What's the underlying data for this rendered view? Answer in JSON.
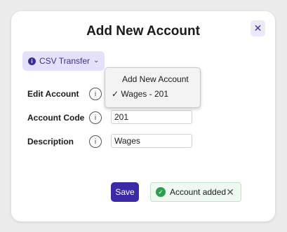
{
  "modal": {
    "title": "Add New Account",
    "close_glyph": "✕"
  },
  "csv_button": {
    "label": "CSV Transfer",
    "info_glyph": "i",
    "chevron_glyph": "⌄"
  },
  "form": {
    "info_glyph": "i",
    "edit_account_label": "Edit Account",
    "account_code_label": "Account Code",
    "account_code_value": "201",
    "description_label": "Description",
    "description_value": "Wages"
  },
  "dropdown": {
    "items": [
      {
        "label": "Add New Account",
        "checked": false
      },
      {
        "label": "Wages - 201",
        "checked": true
      }
    ],
    "check_glyph": "✓"
  },
  "save_button": {
    "label": "Save"
  },
  "toast": {
    "message": "Account added",
    "check_glyph": "✓",
    "close_glyph": "✕"
  },
  "colors": {
    "accent": "#3a2aa8",
    "accent_light": "#e6e1fa",
    "success": "#2e9d52",
    "toast_bg": "#eefaf1"
  }
}
